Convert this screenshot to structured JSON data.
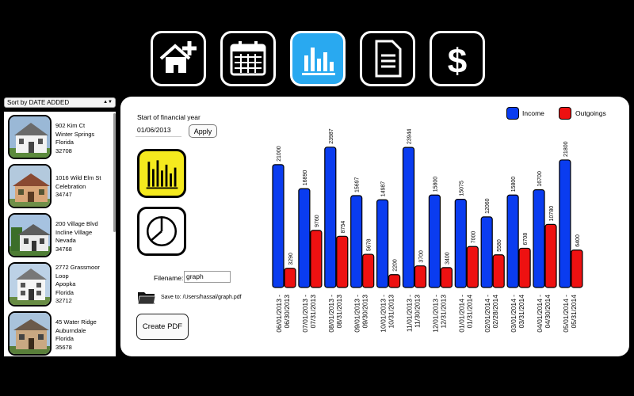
{
  "toolbar": {
    "buttons": [
      {
        "name": "add-property",
        "icon": "house-plus-icon"
      },
      {
        "name": "calendar",
        "icon": "calendar-icon"
      },
      {
        "name": "charts",
        "icon": "bar-chart-icon",
        "active": true
      },
      {
        "name": "documents",
        "icon": "document-icon"
      },
      {
        "name": "finance",
        "icon": "dollar-icon"
      }
    ],
    "active_color": "#29a9f0"
  },
  "sidebar": {
    "sort_label": "Sort by DATE ADDED",
    "properties": [
      {
        "line1": "902 Kim Ct",
        "line2": "Winter Springs",
        "line3": "Florida",
        "line4": "32708",
        "line5": ""
      },
      {
        "line1": "1016 Wild Elm St",
        "line2": "Celebration",
        "line3": "34747",
        "line4": "",
        "line5": ""
      },
      {
        "line1": "200 Village Blvd",
        "line2": "Incline Village",
        "line3": "Nevada",
        "line4": "34768",
        "line5": ""
      },
      {
        "line1": "2772 Grassmoor",
        "line2": "Loop",
        "line3": "Apopka",
        "line4": "Florida",
        "line5": "32712"
      },
      {
        "line1": "45 Water Ridge",
        "line2": "Auburndale",
        "line3": "Florida",
        "line4": "35678",
        "line5": ""
      }
    ]
  },
  "main": {
    "fy_label": "Start of financial year",
    "fy_value": "01/06/2013",
    "apply_label": "Apply",
    "filename_label": "Filename:",
    "filename_value": "graph",
    "save_to": "Save to: /Users/hassal/graph.pdf",
    "create_pdf_label": "Create PDF",
    "bar_chart_icon": "bar-chart-icon",
    "pie_chart_icon": "pie-chart-icon",
    "folder_icon": "folder-icon"
  },
  "chart_data": {
    "type": "bar",
    "categories": [
      "06/01/2013 - 06/30/2013",
      "07/01/2013 - 07/31/2013",
      "08/01/2013 - 08/31/2013",
      "09/01/2013 - 09/30/2013",
      "10/01/2013 - 10/31/2013",
      "11/01/2013 - 11/30/2013",
      "12/01/2013 - 12/31/2013",
      "01/01/2014 - 01/31/2014",
      "02/01/2014 - 02/28/2014",
      "03/01/2014 - 03/31/2014",
      "04/01/2014 - 04/30/2014",
      "05/01/2014 - 05/31/2014"
    ],
    "cat_lines": [
      [
        "06/01/2013 -",
        "06/30/2013"
      ],
      [
        "07/01/2013 -",
        "07/31/2013"
      ],
      [
        "08/01/2013 -",
        "08/31/2013"
      ],
      [
        "09/01/2013 -",
        "09/30/2013"
      ],
      [
        "10/01/2013 -",
        "10/31/2013"
      ],
      [
        "11/01/2013 -",
        "11/30/2013"
      ],
      [
        "12/01/2013 -",
        "12/31/2013"
      ],
      [
        "01/01/2014 -",
        "01/31/2014"
      ],
      [
        "02/01/2014 -",
        "02/28/2014"
      ],
      [
        "03/01/2014 -",
        "03/31/2014"
      ],
      [
        "04/01/2014 -",
        "04/30/2014"
      ],
      [
        "05/01/2014 -",
        "05/31/2014"
      ]
    ],
    "series": [
      {
        "name": "Income",
        "color": "#0a3cf0",
        "values": [
          21000,
          16890,
          23987,
          15697,
          14987,
          23944,
          15800,
          15075,
          12060,
          15800,
          16700,
          21800
        ]
      },
      {
        "name": "Outgoings",
        "color": "#ee1111",
        "values": [
          3290,
          9760,
          8754,
          5678,
          2200,
          3700,
          3400,
          7000,
          5580,
          6708,
          10780,
          6400
        ]
      }
    ],
    "legend_position": "top-right",
    "grid": false,
    "ylim": [
      0,
      24500
    ]
  }
}
